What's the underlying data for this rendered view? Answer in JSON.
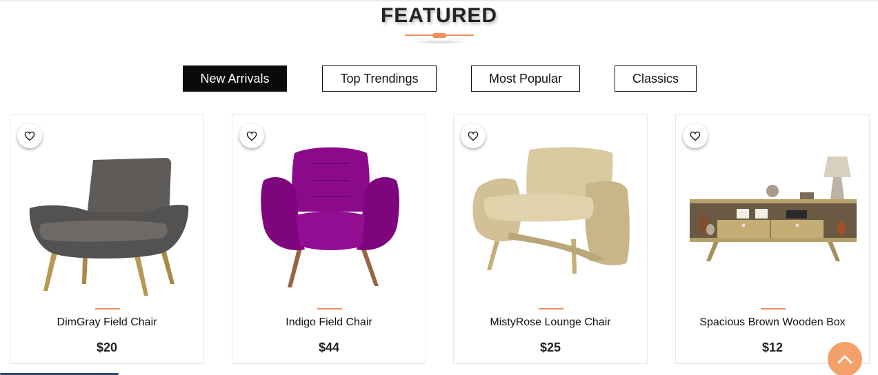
{
  "section": {
    "title": "FEATURED",
    "accent_color": "#f0925a"
  },
  "tabs": [
    {
      "label": "New Arrivals",
      "active": true
    },
    {
      "label": "Top Trendings",
      "active": false
    },
    {
      "label": "Most Popular",
      "active": false
    },
    {
      "label": "Classics",
      "active": false
    }
  ],
  "products": [
    {
      "name": "DimGray Field Chair",
      "price": "$20",
      "image": "gray-armchair",
      "wishlist_icon": "heart-icon"
    },
    {
      "name": "Indigo Field Chair",
      "price": "$44",
      "image": "purple-armchair",
      "wishlist_icon": "heart-icon"
    },
    {
      "name": "MistyRose Lounge Chair",
      "price": "$25",
      "image": "beige-lounge-chair",
      "wishlist_icon": "heart-icon"
    },
    {
      "name": "Spacious Brown Wooden Box",
      "price": "$12",
      "image": "wooden-tv-console",
      "wishlist_icon": "heart-icon"
    }
  ],
  "scroll_top": {
    "icon": "chevron-up-icon",
    "color": "#f4a06a"
  }
}
